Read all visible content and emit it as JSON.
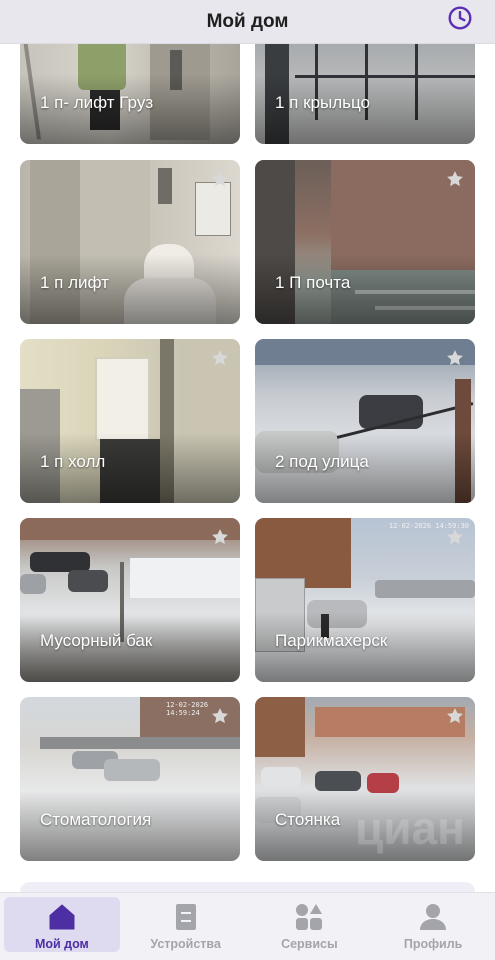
{
  "header": {
    "title": "Мой дом",
    "history_icon": "clock-icon",
    "accent": "#5b2fb3"
  },
  "cameras": [
    {
      "label": "1 п- лифт Груз",
      "favorite": false
    },
    {
      "label": "1 п крыльцо",
      "favorite": false
    },
    {
      "label": "1 п лифт",
      "favorite": false
    },
    {
      "label": "1 П почта",
      "favorite": false
    },
    {
      "label": "1 п холл",
      "favorite": false
    },
    {
      "label": "2 под улица",
      "favorite": false
    },
    {
      "label": "Мусорный бак",
      "favorite": false
    },
    {
      "label": "Парикмахерск",
      "favorite": false
    },
    {
      "label": "Стоматология",
      "favorite": false
    },
    {
      "label": "Стоянка",
      "favorite": false
    }
  ],
  "timestamps": {
    "barber": "12-02-2026 14:59:30",
    "dent": "12-02-2026 14:59:24"
  },
  "watermark": "циан",
  "nav": {
    "items": [
      {
        "label": "Мой дом",
        "icon": "home-icon",
        "active": true
      },
      {
        "label": "Устройства",
        "icon": "devices-icon",
        "active": false
      },
      {
        "label": "Сервисы",
        "icon": "services-icon",
        "active": false
      },
      {
        "label": "Профиль",
        "icon": "profile-icon",
        "active": false
      }
    ],
    "active_color": "#4d2ea3",
    "inactive_color": "#a4a4ab"
  }
}
